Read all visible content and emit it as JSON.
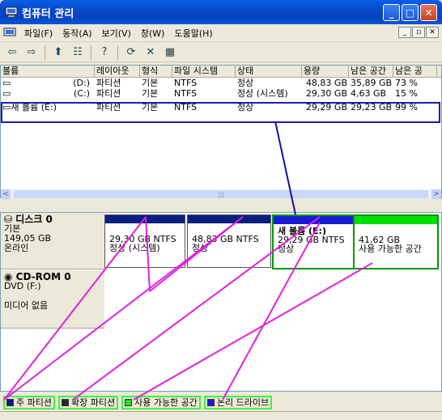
{
  "window": {
    "title": "컴퓨터 관리",
    "min": "_",
    "max": "□",
    "close": "✕"
  },
  "menu": [
    "파일(F)",
    "동작(A)",
    "보기(V)",
    "창(W)",
    "도움말(H)"
  ],
  "mdi": [
    "_",
    "▫",
    "✕"
  ],
  "toolbar": {
    "back": "⇦",
    "forward": "⇨",
    "up": "⬆",
    "props": "☷",
    "help": "?",
    "refresh": "⟳",
    "delete": "✕",
    "export": "▦"
  },
  "columns": [
    "볼륨",
    "레이아웃",
    "형식",
    "파일 시스템",
    "상태",
    "용량",
    "남은 공간",
    "남은 공"
  ],
  "volumes": [
    {
      "name": "(D:)",
      "layout": "파티션",
      "type": "기본",
      "fs": "NTFS",
      "status": "정상",
      "capacity": "48,83 GB",
      "free": "35,89 GB",
      "pct": "73 %"
    },
    {
      "name": "(C:)",
      "layout": "파티션",
      "type": "기본",
      "fs": "NTFS",
      "status": "정상 (시스템)",
      "capacity": "29,30 GB",
      "free": "4,63 GB",
      "pct": "15 %"
    },
    {
      "name": "새 볼륨 (E:)",
      "layout": "파티션",
      "type": "기본",
      "fs": "NTFS",
      "status": "정상",
      "capacity": "29,29 GB",
      "free": "29,23 GB",
      "pct": "99 %"
    }
  ],
  "disk0": {
    "name": "디스크 0",
    "type": "기본",
    "size": "149,05 GB",
    "state": "온라인",
    "parts": [
      {
        "title": "",
        "l1": "29,30 GB NTFS",
        "l2": "정상 (시스템)"
      },
      {
        "title": "",
        "l1": "48,83 GB NTFS",
        "l2": "정상"
      },
      {
        "title": "새 볼륨 (E:)",
        "l1": "29,29 GB NTFS",
        "l2": "정상"
      },
      {
        "title": "",
        "l1": "41,62 GB",
        "l2": "사용 가능한 공간"
      }
    ]
  },
  "cdrom": {
    "name": "CD-ROM 0",
    "drive": "DVD (F:)",
    "media": "미디어 없음"
  },
  "legend": [
    {
      "label": "주 파티션",
      "color": "#0a1e7e"
    },
    {
      "label": "확장 파티션",
      "color": "#2a2a2a"
    },
    {
      "label": "사용 가능한 공간",
      "color": "#22dd22"
    },
    {
      "label": "논리 드라이브",
      "color": "#1a1adf"
    }
  ],
  "scroll": {
    "left": "<",
    "right": ">",
    "grip": "|||"
  },
  "colors": {
    "primary": "#0a1e7e",
    "free": "#00e000",
    "annotation": "#e020e0"
  }
}
